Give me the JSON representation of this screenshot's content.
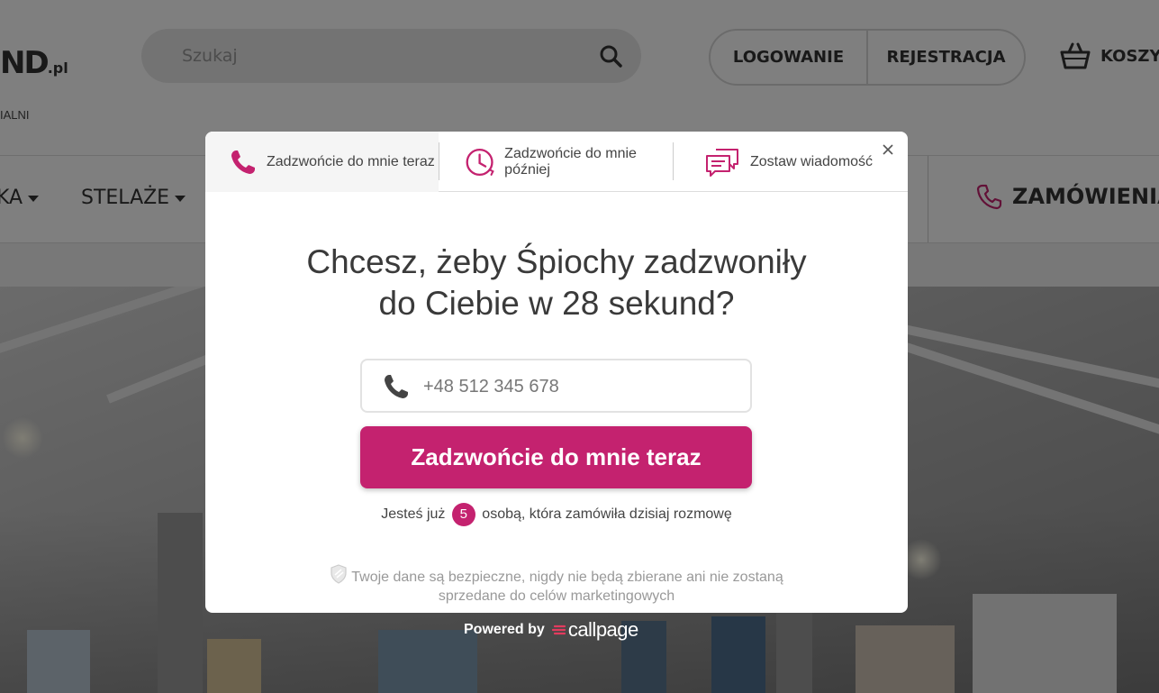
{
  "header": {
    "logo_text": "ND",
    "logo_suffix": ".pl",
    "logo_sub": "IALNI",
    "search_placeholder": "Szukaj",
    "login_label": "LOGOWANIE",
    "register_label": "REJESTRACJA",
    "cart_label": "KOSZYK"
  },
  "nav": {
    "items": [
      "KA",
      "STELAŻE"
    ],
    "orders_label": "ZAMÓWIENIA"
  },
  "modal": {
    "tabs": [
      {
        "label": "Zadzwońcie do mnie teraz",
        "icon": "phone-icon",
        "active": true
      },
      {
        "label": "Zadzwońcie do mnie później",
        "icon": "clock-icon",
        "active": false
      },
      {
        "label": "Zostaw wiadomość",
        "icon": "chat-icon",
        "active": false
      }
    ],
    "headline_line1": "Chcesz, żeby Śpiochy zadzwoniły",
    "headline_line2": "do Ciebie w 28 sekund?",
    "phone_placeholder": "+48 512 345 678",
    "cta_label": "Zadzwońcie do mnie teraz",
    "counter_before": "Jesteś już",
    "counter_value": "5",
    "counter_after": "osobą, która zamówiła dzisiaj rozmowę",
    "secure_line1": "Twoje dane są bezpieczne, nigdy nie będą zbierane ani nie zostaną",
    "secure_line2": "sprzedane do celów marketingowych"
  },
  "powered": {
    "label": "Powered by",
    "brand": "callpage"
  },
  "colors": {
    "accent": "#c4226f",
    "overlay": "rgba(0,0,0,0.5)"
  }
}
